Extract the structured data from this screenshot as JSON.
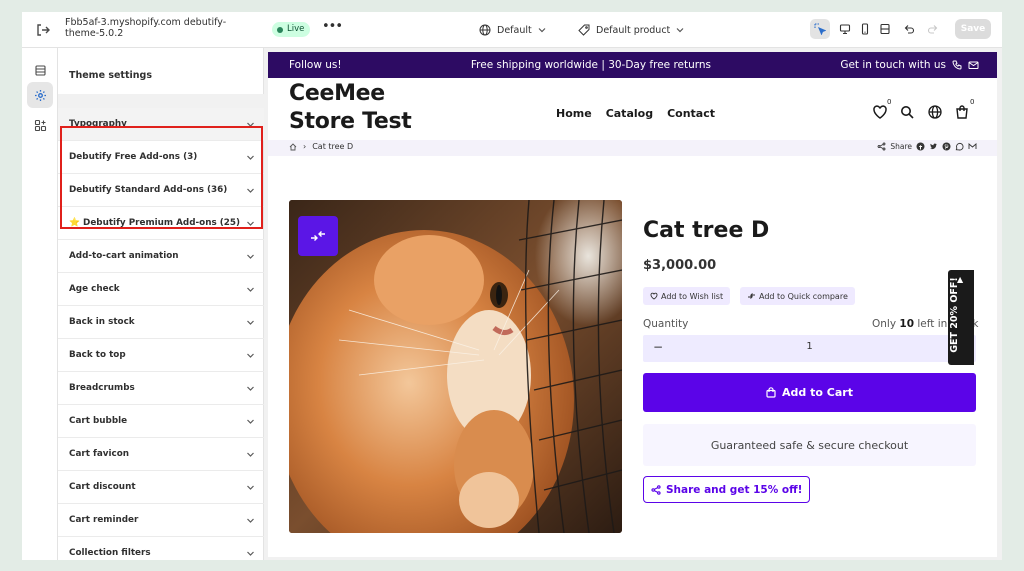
{
  "topbar": {
    "store_name": "Fbb5af-3.myshopify.com debutify-theme-5.0.2",
    "live_label": "Live",
    "more_label": "•••",
    "default_label": "Default",
    "product_label": "Default product",
    "save_label": "Save"
  },
  "sidebar": {
    "title": "Theme settings",
    "items": [
      {
        "label": "Typography"
      },
      {
        "label": "Debutify Free Add-ons (3)"
      },
      {
        "label": "Debutify Standard Add-ons (36)"
      },
      {
        "label": "⭐ Debutify Premium Add-ons (25)"
      },
      {
        "label": "Add-to-cart animation"
      },
      {
        "label": "Age check"
      },
      {
        "label": "Back in stock"
      },
      {
        "label": "Back to top"
      },
      {
        "label": "Breadcrumbs"
      },
      {
        "label": "Cart bubble"
      },
      {
        "label": "Cart favicon"
      },
      {
        "label": "Cart discount"
      },
      {
        "label": "Cart reminder"
      },
      {
        "label": "Collection filters"
      }
    ]
  },
  "store": {
    "announcement": {
      "left": "Follow us!",
      "center": "Free shipping worldwide | 30-Day free returns",
      "right": "Get in touch with us"
    },
    "logo_line1": "CeeMee",
    "logo_line2": "Store Test",
    "nav": [
      "Home",
      "Catalog",
      "Contact"
    ],
    "wishlist_count": "0",
    "cart_count": "0",
    "breadcrumb": "Cat tree D",
    "share_label": "Share"
  },
  "product": {
    "title": "Cat tree D",
    "price": "$3,000.00",
    "wishlist_label": "Add to Wish list",
    "compare_label": "Add to Quick compare",
    "quantity_label": "Quantity",
    "stock_prefix": "Only",
    "stock_count": "10",
    "stock_suffix": "left in stock",
    "quantity_value": "1",
    "minus": "−",
    "plus": "+",
    "add_to_cart": "Add to Cart",
    "secure_text": "Guaranteed safe & secure checkout",
    "share_discount": "Share and get 15% off!"
  },
  "discount_tab": {
    "label": "GET 20% OFF!"
  },
  "colors": {
    "announcement_bg": "#2d0b63",
    "accent": "#5b04e8",
    "highlight": "#e0201b"
  }
}
